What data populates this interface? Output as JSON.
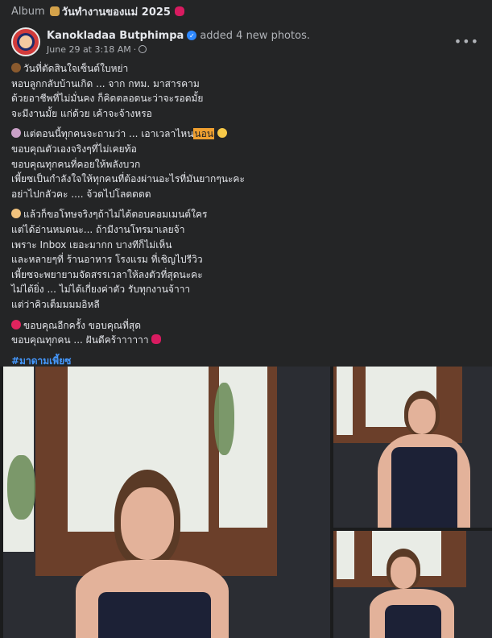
{
  "album": {
    "label": "Album",
    "title": "วันทำงานของแม่ 2025"
  },
  "post": {
    "author": "Kanokladaa Butphimpa",
    "action": "added 4 new photos.",
    "timestamp": "June 29 at 3:18 AM",
    "more_label": "•••",
    "paragraphs": [
      {
        "emoji": "e-heart-brown",
        "lines": [
          "วันที่ตัดสินใจเซ็นต์ใบหย่า",
          "หอบลูกกลับบ้านเกิด ... จาก กทม. มาสารคาม",
          "ด้วยอาชีพที่ไม่มั่นคง ก็คิดตลอดนะว่าจะรอดมั้ย",
          "จะมีงานมั้ย แก่ด้วย เค้าจะจ้างหรอ"
        ]
      },
      {
        "emoji": "e-person",
        "lines": [
          "แต่ตอนนี้ทุกคนจะถามว่า ... เอาเวลาไหน",
          "ขอบคุณตัวเองจริงๆที่ไม่เคยท้อ",
          "ขอบคุณทุกคนที่คอยให้พลังบวก",
          "เพี้ยซเป็นกำลังใจให้ทุกคนที่ต้องผ่านอะไรที่มันยากๆนะคะ",
          "อย่าไปกลัวคะ .... จ้วดไปโลดดดด"
        ],
        "highlight": "นอน"
      },
      {
        "emoji": "e-pray",
        "lines": [
          "แล้วก็ขอโทษจริงๆถ้าไม่ได้ตอบคอมเมนต์ใคร",
          "แต่ได้อ่านหมดนะ... ถ้ามีงานโทรมาเลยจ้า",
          "เพราะ Inbox เยอะมากก บางทีก็ไม่เห็น",
          "และหลายๆที่ ร้านอาหาร โรงแรม ที่เชิญไปรีวิว",
          "เพี้ยซจะพยายามจัดสรรเวลาให้ลงตัวที่สุดนะคะ",
          "ไม่ได้ยิ่ง ... ไม่ได้เกี่ยงค่าตัว รับทุกงานจ้าาา",
          "แต่ว่าคิวเต็มมมมอิหลี"
        ]
      },
      {
        "emoji": "e-heart-red",
        "lines": [
          "ขอบคุณอีกครั้ง ขอบคุณที่สุด",
          "ขอบคุณทุกคน ... ฝันดีคร้าาาาาา"
        ]
      }
    ],
    "hashtag": "#มาดามเพี้ยซ"
  },
  "photos": [
    {
      "label": "main-photo"
    },
    {
      "label": "top-right-photo"
    },
    {
      "label": "bottom-right-photo"
    }
  ],
  "colors": {
    "background": "#242526",
    "text": "#e4e6eb",
    "secondary_text": "#b0b3b8",
    "link": "#4599ff",
    "highlight": "#f0a030"
  }
}
